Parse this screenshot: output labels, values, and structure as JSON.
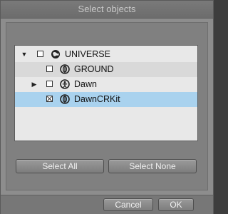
{
  "window": {
    "title": "Select objects"
  },
  "tree": [
    {
      "label": "UNIVERSE",
      "icon": "globe-icon",
      "checked": false,
      "expander": "expanded"
    },
    {
      "label": "GROUND",
      "icon": "prop-icon",
      "checked": false,
      "expander": "none"
    },
    {
      "label": "Dawn",
      "icon": "figure-icon",
      "checked": false,
      "expander": "collapsed"
    },
    {
      "label": "DawnCRKit",
      "icon": "prop-icon",
      "checked": true,
      "expander": "none",
      "selected": true
    }
  ],
  "buttons": {
    "select_all": "Select All",
    "select_none": "Select None",
    "cancel": "Cancel",
    "ok": "OK"
  },
  "colors": {
    "selection": "#a9d2ee",
    "panel": "#808080",
    "list_background": "#e8e8e8"
  }
}
